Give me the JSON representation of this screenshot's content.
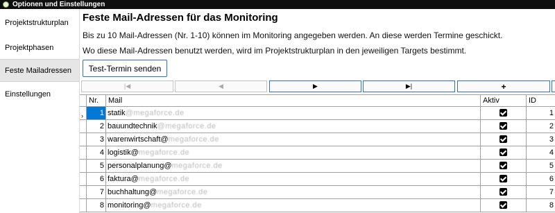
{
  "window": {
    "title": "Optionen und Einstellungen"
  },
  "sidebar": {
    "items": [
      {
        "label": "Projektstrukturplan"
      },
      {
        "label": "Projektphasen"
      },
      {
        "label": "Feste Mailadressen",
        "active": true
      },
      {
        "label": "Einstellungen"
      }
    ]
  },
  "main": {
    "title": "Feste Mail-Adressen für das Monitoring",
    "description_1": "Bis zu 10 Mail-Adressen (Nr. 1-10) können im Monitoring angegeben werden. An diese werden Termine geschickt.",
    "description_2": "Wo diese Mail-Adressen benutzt werden, wird im Projektstrukturplan in den jeweiligen Targets bestimmt.",
    "test_button": "Test-Termin senden"
  },
  "navigator": {
    "first_icon": "|◀",
    "prev_icon": "◀",
    "next_icon": "▶",
    "last_icon": "▶|",
    "add_icon": "+"
  },
  "grid": {
    "columns": {
      "nr": "Nr.",
      "mail": "Mail",
      "aktiv": "Aktiv",
      "id": "ID"
    },
    "current_row_marker": "›",
    "rows": [
      {
        "nr": "1",
        "mail_visible": "statik",
        "mail_obscured": "@megaforce.de",
        "aktiv": true,
        "id": "1"
      },
      {
        "nr": "2",
        "mail_visible": "bauundtechnik",
        "mail_obscured": "@megaforce.de",
        "aktiv": true,
        "id": "2"
      },
      {
        "nr": "3",
        "mail_visible": "warenwirtschaft@",
        "mail_obscured": "megaforce.de",
        "aktiv": true,
        "id": "3"
      },
      {
        "nr": "4",
        "mail_visible": "logistik@",
        "mail_obscured": "megaforce.de",
        "aktiv": true,
        "id": "4"
      },
      {
        "nr": "5",
        "mail_visible": "personalplanung@",
        "mail_obscured": "megaforce.de",
        "aktiv": true,
        "id": "5"
      },
      {
        "nr": "6",
        "mail_visible": "faktura@",
        "mail_obscured": "megaforce.de",
        "aktiv": true,
        "id": "6"
      },
      {
        "nr": "7",
        "mail_visible": "buchhaltung@",
        "mail_obscured": "megaforce.de",
        "aktiv": true,
        "id": "7"
      },
      {
        "nr": "8",
        "mail_visible": "monitoring@",
        "mail_obscured": "megaforce.de",
        "aktiv": true,
        "id": "8"
      }
    ]
  }
}
